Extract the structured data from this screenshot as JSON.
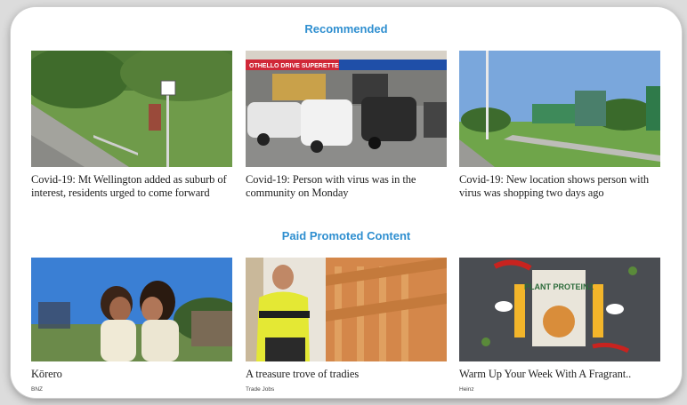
{
  "recommended": {
    "heading": "Recommended",
    "items": [
      {
        "headline": "Covid-19: Mt Wellington added as suburb of interest, residents urged to come forward",
        "image_alt": "street-scene-photo"
      },
      {
        "headline": "Covid-19: Person with virus was in the community on Monday",
        "image_alt": "superette-carpark-photo",
        "sign_text": "OTHELLO DRIVE SUPERETTE"
      },
      {
        "headline": "Covid-19: New location shows person with virus was shopping two days ago",
        "image_alt": "shopping-centre-photo"
      }
    ]
  },
  "paid": {
    "heading": "Paid Promoted Content",
    "items": [
      {
        "headline": "Kōrero",
        "source": "BNZ",
        "image_alt": "two-girls-photo"
      },
      {
        "headline": "A treasure trove of tradies",
        "source": "Trade Jobs",
        "image_alt": "tradie-photo"
      },
      {
        "headline": "Warm Up Your Week With A Fragrant..",
        "source": "Heinz",
        "image_alt": "plant-proteinz-photo",
        "book_title": "PLANT PROTEINZ"
      }
    ]
  },
  "colors": {
    "accent": "#2f8fd0",
    "text": "#1f1f1f"
  }
}
